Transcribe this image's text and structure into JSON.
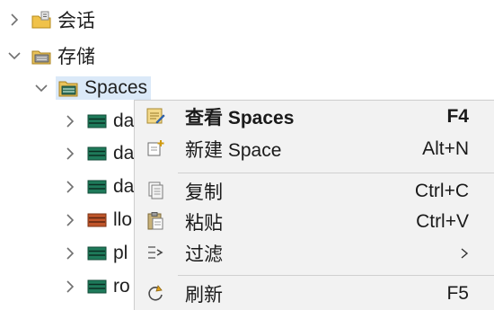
{
  "tree": {
    "sessions": {
      "label": "会话",
      "icon": "folder-settings-icon",
      "expanded": false
    },
    "storage": {
      "label": "存储",
      "icon": "folder-storage-icon",
      "expanded": true
    },
    "spaces": {
      "label": "Spaces",
      "icon": "spaces-icon",
      "expanded": true,
      "selected": true
    },
    "children": [
      {
        "label": "da",
        "icon": "space-icon",
        "icon_color": "#1e7a5a"
      },
      {
        "label": "da",
        "icon": "space-icon",
        "icon_color": "#1e7a5a"
      },
      {
        "label": "da",
        "icon": "space-icon",
        "icon_color": "#1e7a5a"
      },
      {
        "label": "llo",
        "icon": "space-icon",
        "icon_color": "#c0552a"
      },
      {
        "label": "pl",
        "icon": "space-icon",
        "icon_color": "#1e7a5a"
      },
      {
        "label": "ro",
        "icon": "space-icon",
        "icon_color": "#1e7a5a"
      }
    ]
  },
  "context_menu": {
    "items": [
      {
        "label": "查看 Spaces",
        "shortcut": "F4",
        "icon": "view-icon",
        "bold": true,
        "highlighted": true
      },
      {
        "label": "新建 Space",
        "shortcut": "Alt+N",
        "icon": "new-space-icon"
      },
      {
        "label": "复制",
        "shortcut": "Ctrl+C",
        "icon": "copy-icon"
      },
      {
        "label": "粘贴",
        "shortcut": "Ctrl+V",
        "icon": "paste-icon"
      },
      {
        "label": "过滤",
        "shortcut": "",
        "icon": "filter-icon",
        "submenu": true
      },
      {
        "label": "刷新",
        "shortcut": "F5",
        "icon": "refresh-icon"
      }
    ]
  }
}
